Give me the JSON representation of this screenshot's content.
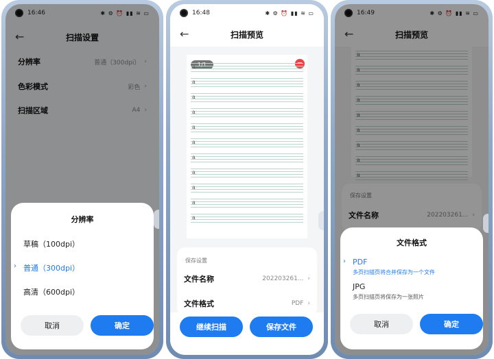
{
  "panel1": {
    "time": "16:46",
    "title": "扫描设置",
    "settings": [
      {
        "label": "分辨率",
        "value": "普通（300dpi）"
      },
      {
        "label": "色彩模式",
        "value": "彩色"
      },
      {
        "label": "扫描区域",
        "value": "A4"
      }
    ],
    "sheet": {
      "title": "分辨率",
      "options": [
        "草稿（100dpi）",
        "普通（300dpi）",
        "高清（600dpi）"
      ],
      "cancel": "取消",
      "confirm": "确定"
    }
  },
  "panel2": {
    "time": "16:48",
    "title": "扫描预览",
    "page_indicator": "1/1",
    "letter": "a",
    "section_label": "保存设置",
    "file_name_label": "文件名称",
    "file_name_value": "202203261...",
    "file_format_label": "文件格式",
    "file_format_value": "PDF",
    "continue_button": "继续扫描",
    "save_button": "保存文件"
  },
  "panel3": {
    "time": "16:49",
    "title": "扫描预览",
    "letter": "a",
    "section_label": "保存设置",
    "file_name_label": "文件名称",
    "file_name_value": "202203261...",
    "sheet": {
      "title": "文件格式",
      "pdf_label": "PDF",
      "pdf_desc": "多页扫描页将合并保存为一个文件",
      "jpg_label": "JPG",
      "jpg_desc": "多页扫描页将保存为一张照片",
      "cancel": "取消",
      "confirm": "确定"
    }
  },
  "colors": {
    "accent": "#1e7bf0",
    "danger": "#f04040"
  },
  "status_icons": "✱ ⚙ ⏰ ▮▮ ≋ ▭"
}
